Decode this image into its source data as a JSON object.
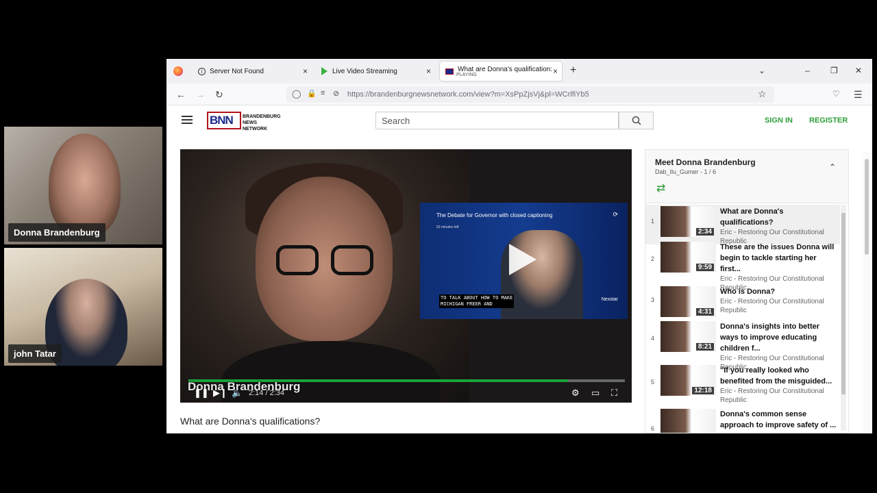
{
  "participants": [
    {
      "name": "Donna Brandenburg"
    },
    {
      "name": "john Tatar"
    }
  ],
  "browser": {
    "tabs": [
      {
        "label": "Server Not Found",
        "close": "×"
      },
      {
        "label": "Live Video Streaming",
        "close": "×"
      },
      {
        "label": "What are Donna's qualification:",
        "sublabel": "PLAYING",
        "close": "×"
      }
    ],
    "new_tab": "+",
    "url": "https://brandenburgnewsnetwork.com/view?m=XsPpZjsVj&pl=WCrlfiYb5"
  },
  "site": {
    "logo_mark": "BNN",
    "logo_text": "BRANDENBURG NEWS NETWORK",
    "search_placeholder": "Search",
    "sign_in": "SIGN IN",
    "register": "REGISTER"
  },
  "video": {
    "overlay_name": "Donna Brandenburg",
    "time": "2:14 / 2:34",
    "progress": 0.87,
    "inset_title": "The Debate for Governor with closed captioning",
    "inset_sub": "53 minutes left",
    "caption": "TO TALK ABOUT HOW TO MAKE\nMICHIGAN FREER AND",
    "inset_logo": "Nexstar",
    "title": "What are Donna's qualifications?"
  },
  "playlist": {
    "title": "Meet Donna Brandenburg",
    "subtitle": "Dab_Ilu_Gumer  -  1 / 6",
    "items": [
      {
        "num": "1",
        "title": "What are Donna's qualifications?",
        "author": "Eric - Restoring Our Constitutional Republic",
        "duration": "2:34"
      },
      {
        "num": "2",
        "title": "These are the issues Donna will begin to tackle starting her first...",
        "author": "Eric - Restoring Our Constitutional Republic",
        "duration": "9:59"
      },
      {
        "num": "3",
        "title": "Who is Donna?",
        "author": "Eric - Restoring Our Constitutional Republic",
        "duration": "4:31"
      },
      {
        "num": "4",
        "title": "Donna's insights into better ways to improve educating children f...",
        "author": "Eric - Restoring Our Constitutional Republic",
        "duration": "8:21"
      },
      {
        "num": "5",
        "title": "\"If you really looked who benefited from the misguided...",
        "author": "Eric - Restoring Our Constitutional Republic",
        "duration": "12:18"
      },
      {
        "num": "6",
        "title": "Donna's common sense approach to improve safety of ...",
        "author": "",
        "duration": ""
      }
    ]
  }
}
